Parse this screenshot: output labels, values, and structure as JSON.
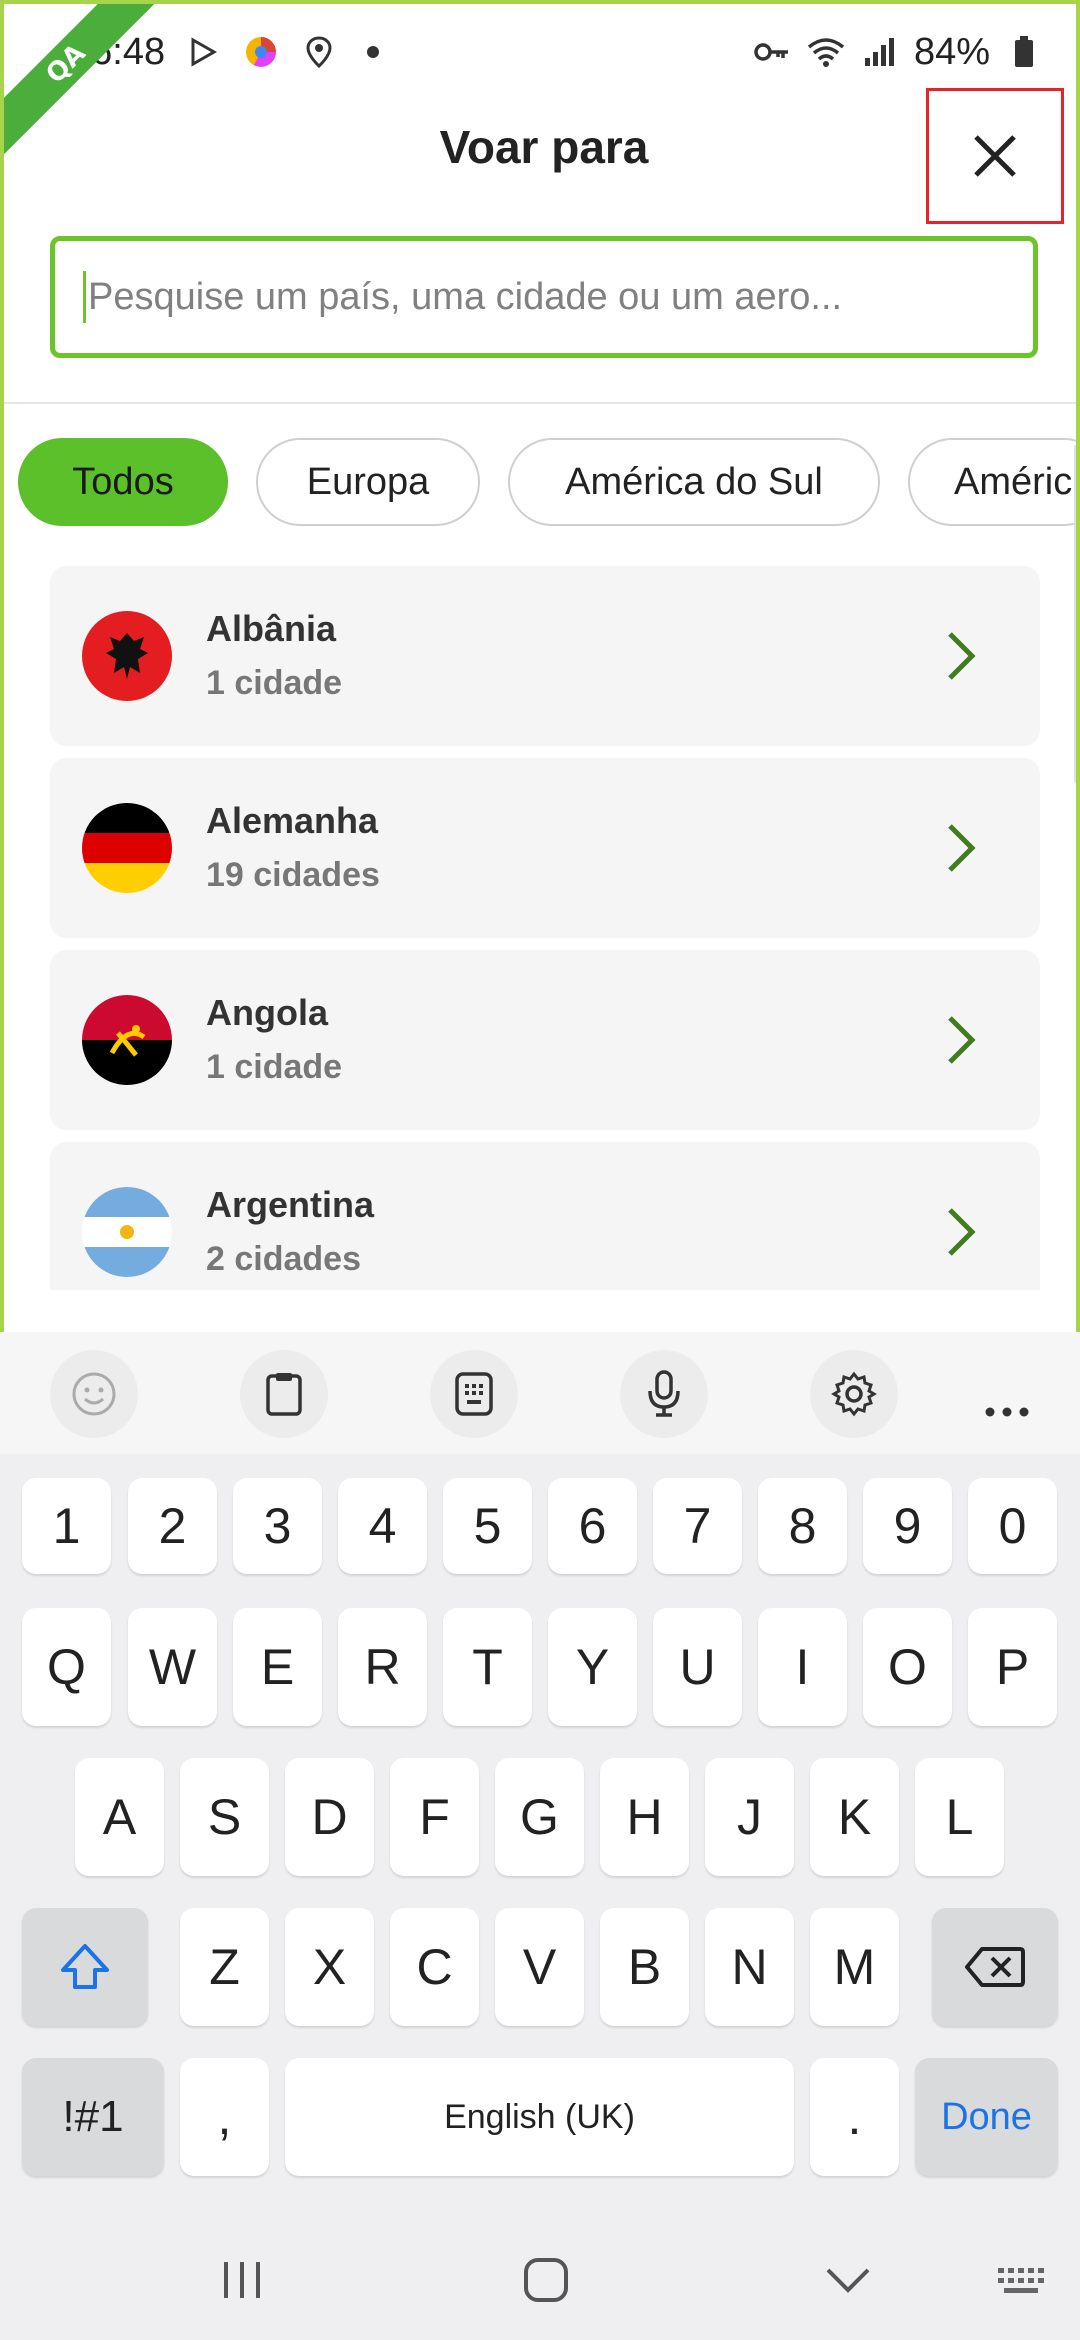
{
  "status_bar": {
    "time": "16:48",
    "battery": "84%",
    "icons": [
      "play-store-icon",
      "chrome-like-icon",
      "location-icon",
      "dot-icon",
      "key-icon",
      "wifi-icon",
      "signal-icon",
      "battery-icon"
    ]
  },
  "ribbon": {
    "label": "QA"
  },
  "header": {
    "title": "Voar para"
  },
  "search": {
    "placeholder": "Pesquise um país, uma cidade ou um aero..."
  },
  "filters": [
    {
      "label": "Todos",
      "active": true
    },
    {
      "label": "Europa",
      "active": false
    },
    {
      "label": "América do Sul",
      "active": false
    },
    {
      "label": "Améric",
      "active": false
    }
  ],
  "countries": [
    {
      "name": "Albânia",
      "count": "1 cidade",
      "flag": "albania-flag-icon"
    },
    {
      "name": "Alemanha",
      "count": "19 cidades",
      "flag": "germany-flag-icon"
    },
    {
      "name": "Angola",
      "count": "1 cidade",
      "flag": "angola-flag-icon"
    },
    {
      "name": "Argentina",
      "count": "2 cidades",
      "flag": "argentina-flag-icon"
    }
  ],
  "keyboard": {
    "toolbar": [
      "emoji-icon",
      "clipboard-icon",
      "keypad-icon",
      "microphone-icon",
      "settings-icon",
      "more-icon"
    ],
    "row1": [
      "1",
      "2",
      "3",
      "4",
      "5",
      "6",
      "7",
      "8",
      "9",
      "0"
    ],
    "row2": [
      "Q",
      "W",
      "E",
      "R",
      "T",
      "Y",
      "U",
      "I",
      "O",
      "P"
    ],
    "row3": [
      "A",
      "S",
      "D",
      "F",
      "G",
      "H",
      "J",
      "K",
      "L"
    ],
    "row4": [
      "Z",
      "X",
      "C",
      "V",
      "B",
      "N",
      "M"
    ],
    "symbols_label": "!#1",
    "comma": ",",
    "space_label": "English (UK)",
    "period": ".",
    "done_label": "Done"
  },
  "colors": {
    "brand_green": "#5cc02a",
    "frame_green": "#a6d44a",
    "highlight_red": "#e3242b",
    "chevron_green": "#3f7d1e",
    "done_blue": "#1a73e8"
  }
}
